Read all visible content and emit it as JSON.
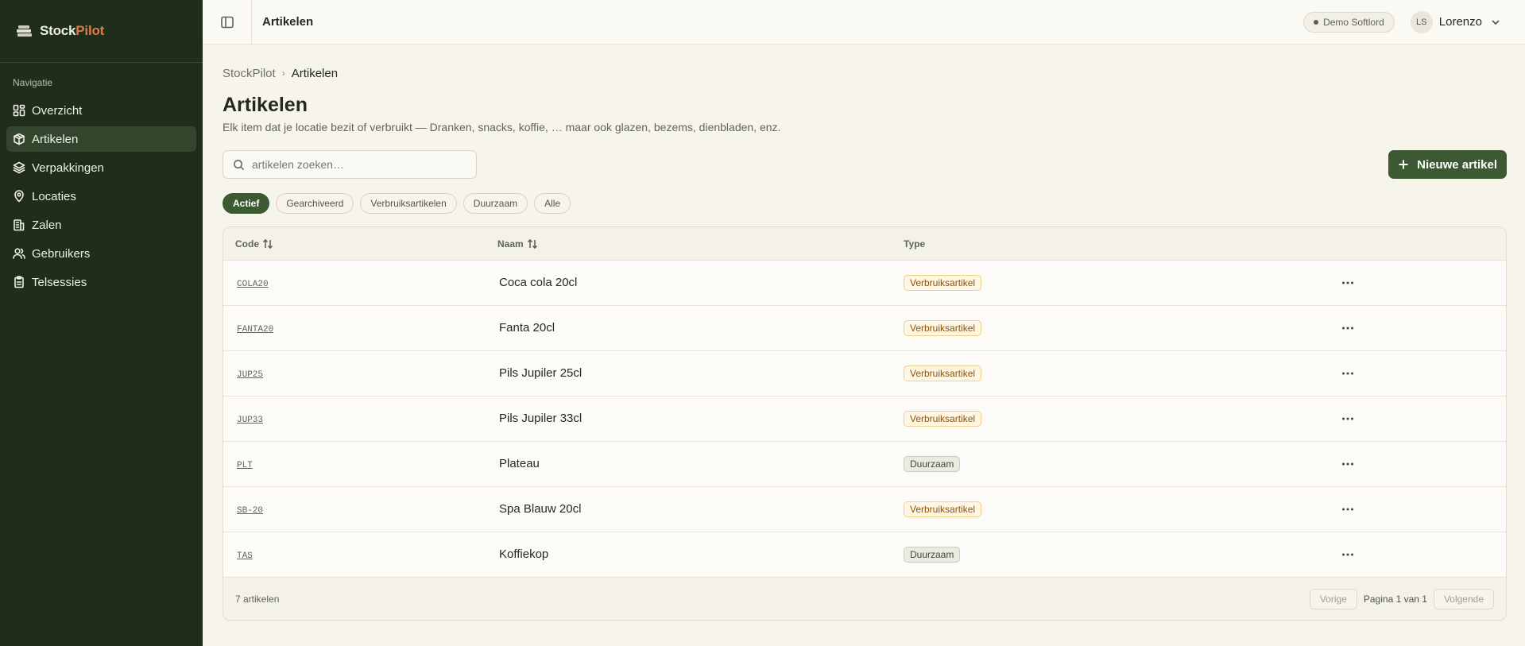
{
  "brand": {
    "name_part1": "Stock",
    "name_part2": "Pilot",
    "accent_color": "#e07a4c",
    "icon": "boxes-stack-icon"
  },
  "sidebar": {
    "section_label": "Navigatie",
    "items": [
      {
        "label": "Overzicht",
        "icon": "dashboard-grid-icon",
        "active": false
      },
      {
        "label": "Artikelen",
        "icon": "package-icon",
        "active": true
      },
      {
        "label": "Verpakkingen",
        "icon": "layers-icon",
        "active": false
      },
      {
        "label": "Locaties",
        "icon": "map-pin-icon",
        "active": false
      },
      {
        "label": "Zalen",
        "icon": "building-icon",
        "active": false
      },
      {
        "label": "Gebruikers",
        "icon": "users-icon",
        "active": false
      },
      {
        "label": "Telsessies",
        "icon": "clipboard-icon",
        "active": false
      }
    ]
  },
  "topbar": {
    "title": "Artikelen",
    "org_badge": "Demo Softlord",
    "user": {
      "initials": "LS",
      "name": "Lorenzo"
    }
  },
  "breadcrumb": {
    "root": "StockPilot",
    "current": "Artikelen"
  },
  "page": {
    "title": "Artikelen",
    "subtitle": "Elk item dat je locatie bezit of verbruikt — Dranken, snacks, koffie, … maar ook glazen, bezems, dienbladen, enz."
  },
  "search": {
    "placeholder": "artikelen zoeken…",
    "value": ""
  },
  "new_button_label": "Nieuwe artikel",
  "filters": [
    {
      "label": "Actief",
      "active": true
    },
    {
      "label": "Gearchiveerd",
      "active": false
    },
    {
      "label": "Verbruiksartikelen",
      "active": false
    },
    {
      "label": "Duurzaam",
      "active": false
    },
    {
      "label": "Alle",
      "active": false
    }
  ],
  "table": {
    "columns": {
      "code": "Code",
      "name": "Naam",
      "type": "Type"
    },
    "rows": [
      {
        "code": "COLA20",
        "name": "Coca cola 20cl",
        "type": "Verbruiksartikel",
        "kind": "verbruik"
      },
      {
        "code": "FANTA20",
        "name": "Fanta 20cl",
        "type": "Verbruiksartikel",
        "kind": "verbruik"
      },
      {
        "code": "JUP25",
        "name": "Pils Jupiler 25cl",
        "type": "Verbruiksartikel",
        "kind": "verbruik"
      },
      {
        "code": "JUP33",
        "name": "Pils Jupiler 33cl",
        "type": "Verbruiksartikel",
        "kind": "verbruik"
      },
      {
        "code": "PLT",
        "name": "Plateau",
        "type": "Duurzaam",
        "kind": "duurzaam"
      },
      {
        "code": "SB-20",
        "name": "Spa Blauw 20cl",
        "type": "Verbruiksartikel",
        "kind": "verbruik"
      },
      {
        "code": "TAS",
        "name": "Koffiekop",
        "type": "Duurzaam",
        "kind": "duurzaam"
      }
    ]
  },
  "footer": {
    "count": "7 artikelen",
    "prev_label": "Vorige",
    "page_info": "Pagina 1 van 1",
    "next_label": "Volgende"
  }
}
